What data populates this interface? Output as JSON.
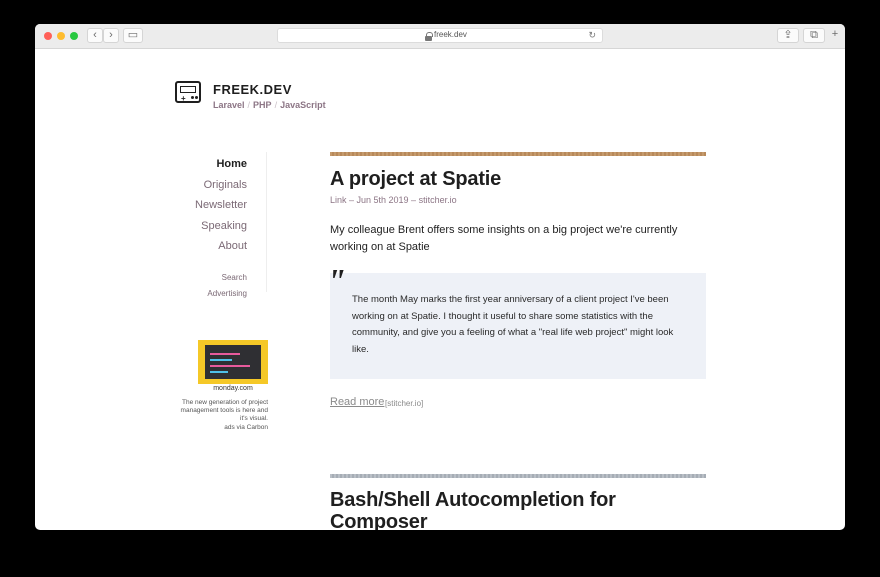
{
  "browser": {
    "url": "freek.dev",
    "back_label": "‹",
    "forward_label": "›",
    "sidebar_label": "▭",
    "share_label": "⇪",
    "tabs_label": "⧉",
    "new_tab_label": "+",
    "reload_label": "↻"
  },
  "header": {
    "title": "FREEK.DEV",
    "links": [
      "Laravel",
      "PHP",
      "JavaScript"
    ],
    "separator": "/"
  },
  "nav": {
    "primary": [
      {
        "label": "Home",
        "active": true
      },
      {
        "label": "Originals"
      },
      {
        "label": "Newsletter"
      },
      {
        "label": "Speaking"
      },
      {
        "label": "About"
      }
    ],
    "secondary": [
      {
        "label": "Search"
      },
      {
        "label": "Advertising"
      }
    ]
  },
  "ad": {
    "brand": "monday.com",
    "text": "The new generation of project management tools is here and it's visual.",
    "via": "ads via Carbon"
  },
  "posts": [
    {
      "title": "A project at Spatie",
      "meta": "Link – Jun 5th 2019 – stitcher.io",
      "intro": "My colleague Brent offers some insights on a big project we're currently working on at Spatie",
      "quote": "The month May marks the first year anniversary of a client project I've been working on at Spatie. I thought it useful to share some statistics with the community, and give you a feeling of what a \"real life web project\" might look like.",
      "quote_mark": "\"",
      "read_more": "Read more",
      "source": "[stitcher.io]"
    },
    {
      "title": "Bash/Shell Autocompletion for Composer"
    }
  ],
  "colors": {
    "accent_brown": "#c49a6c",
    "link_muted": "#8c7585",
    "quote_bg": "#eef1f7",
    "ad_bg": "#f5c827"
  }
}
